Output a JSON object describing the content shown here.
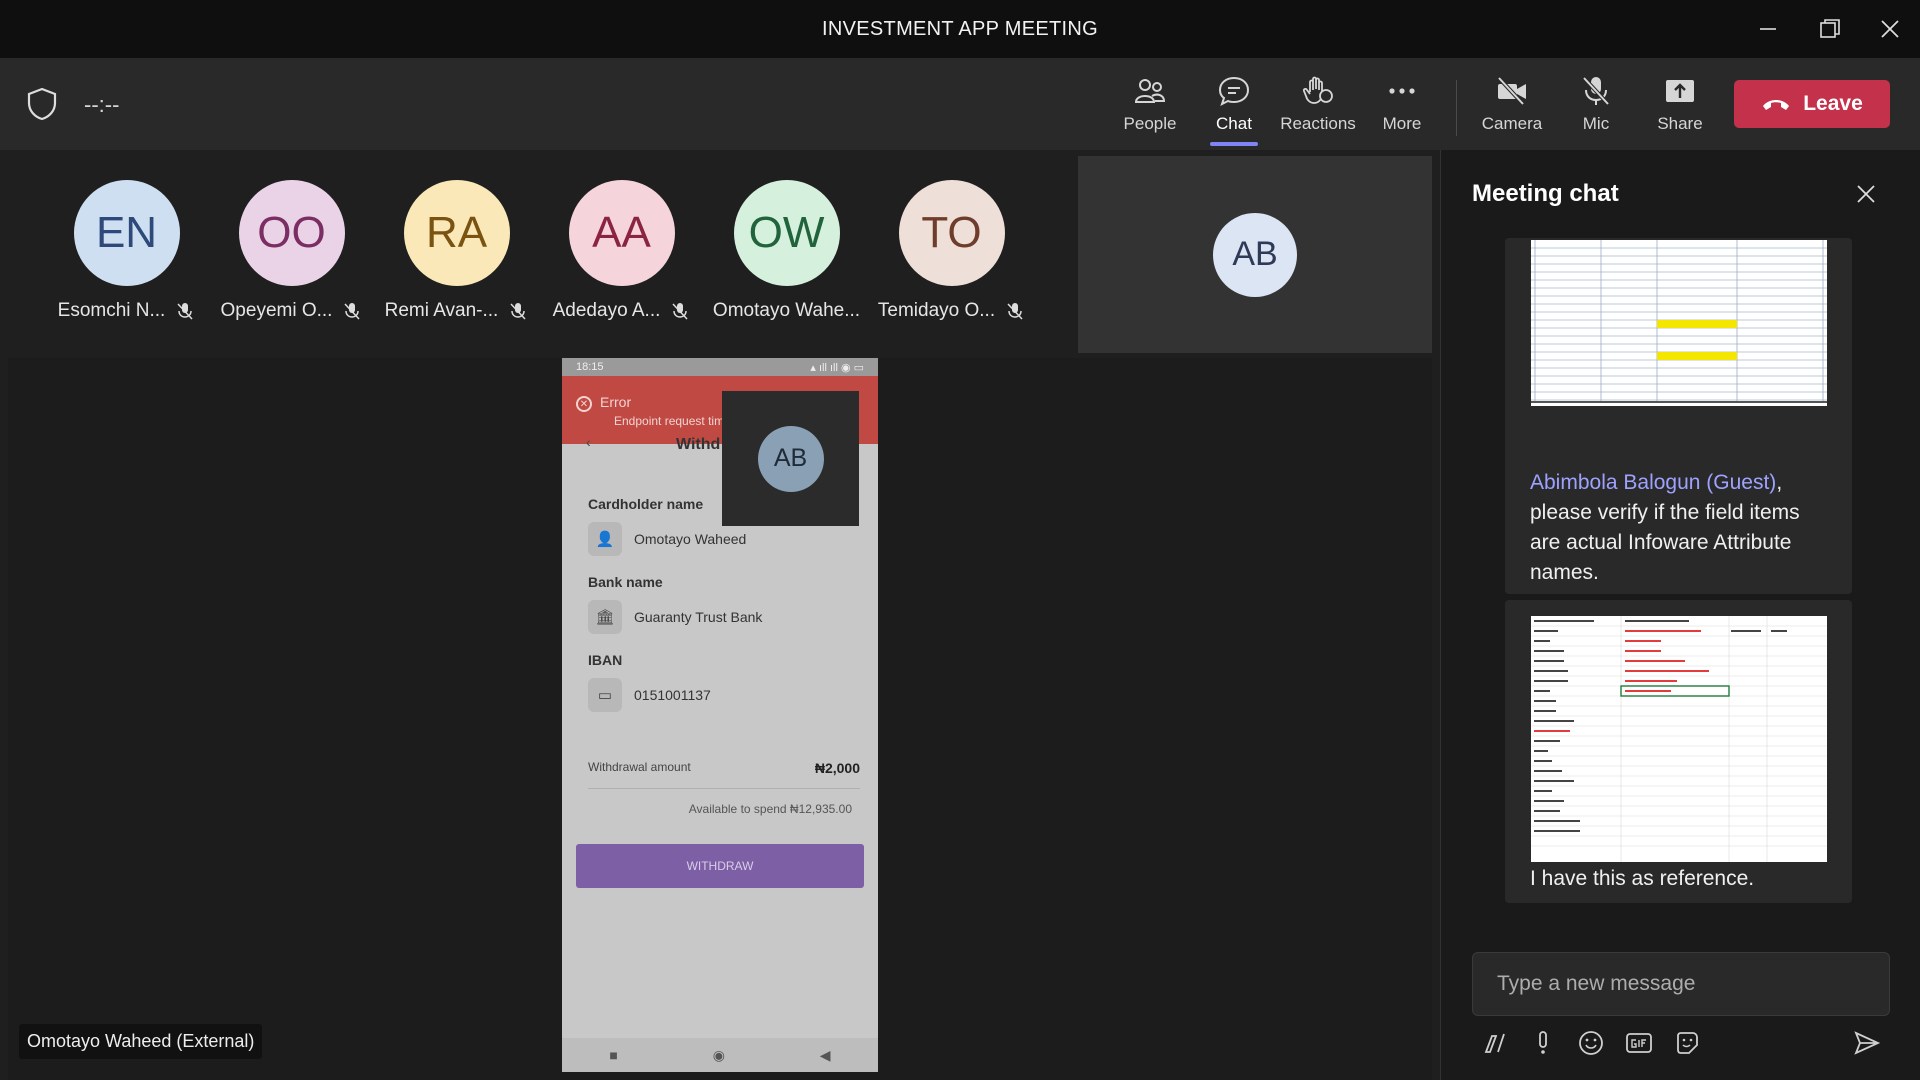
{
  "window": {
    "title": "INVESTMENT APP MEETING"
  },
  "toolbar": {
    "timer": "--:--",
    "buttons": [
      {
        "label": "People",
        "icon": "people-icon"
      },
      {
        "label": "Chat",
        "icon": "chat-icon"
      },
      {
        "label": "Reactions",
        "icon": "reactions-icon"
      },
      {
        "label": "More",
        "icon": "more-icon"
      },
      {
        "label": "Camera",
        "icon": "camera-off-icon"
      },
      {
        "label": "Mic",
        "icon": "mic-off-icon"
      },
      {
        "label": "Share",
        "icon": "share-icon"
      }
    ],
    "leave_label": "Leave"
  },
  "participants": [
    {
      "initials": "EN",
      "name": "Esomchi N...",
      "bg": "#cfdff2",
      "fg": "#2e4a7a"
    },
    {
      "initials": "OO",
      "name": "Opeyemi O...",
      "bg": "#ead3e6",
      "fg": "#7a2e63"
    },
    {
      "initials": "RA",
      "name": "Remi Avan-...",
      "bg": "#fbe8b8",
      "fg": "#7a5312"
    },
    {
      "initials": "AA",
      "name": "Adedayo A...",
      "bg": "#f6d4dc",
      "fg": "#8a2440"
    },
    {
      "initials": "OW",
      "name": "Omotayo Wahe...",
      "bg": "#d5f0dd",
      "fg": "#21633a"
    },
    {
      "initials": "TO",
      "name": "Temidayo O...",
      "bg": "#eedfd9",
      "fg": "#6e3d2c"
    }
  ],
  "self_tile": {
    "initials": "AB"
  },
  "shared_screen": {
    "status_time": "18:15",
    "error_title": "Error",
    "error_detail": "Endpoint request time",
    "screen_title": "Withd",
    "pip_initials": "AB",
    "cardholder_label": "Cardholder name",
    "cardholder_value": "Omotayo  Waheed",
    "bank_label": "Bank name",
    "bank_value": "Guaranty Trust Bank",
    "iban_label": "IBAN",
    "iban_value": "0151001137",
    "amount_label": "Withdrawal amount",
    "amount_value": "₦2,000",
    "available": "Available to spend ₦12,935.00",
    "withdraw_label": "WITHDRAW"
  },
  "presenter_badge": "Omotayo Waheed (External)",
  "chat": {
    "title": "Meeting chat",
    "messages": [
      {
        "mention": "Abimbola Balogun (Guest)",
        "text_after_mention": ",",
        "text": "please verify if the field items are actual Infoware Attribute names."
      },
      {
        "text": "I have this as reference."
      }
    ],
    "composer_placeholder": "Type a new message"
  }
}
